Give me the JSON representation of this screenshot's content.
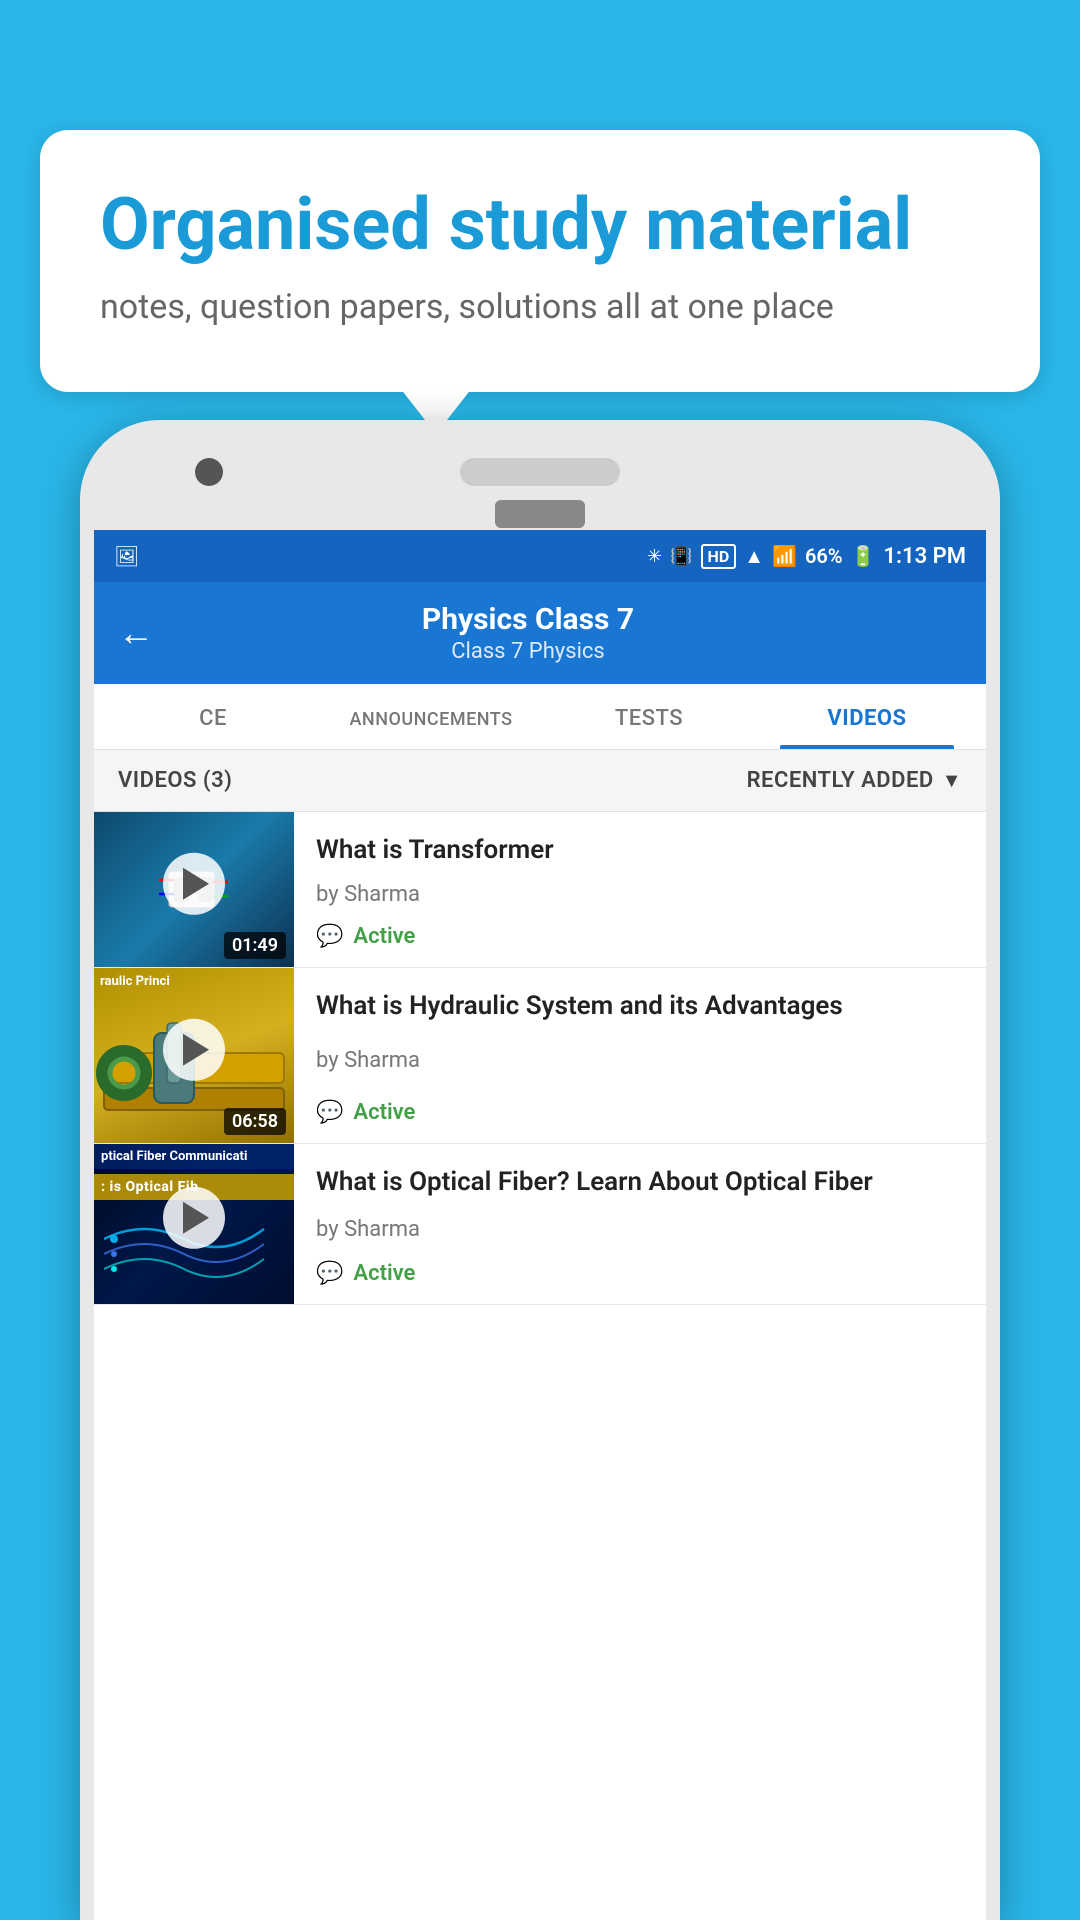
{
  "page": {
    "background_color": "#29b6e8"
  },
  "bubble": {
    "title": "Organised study material",
    "subtitle": "notes, question papers, solutions all at one place"
  },
  "status_bar": {
    "time": "1:13 PM",
    "battery": "66%",
    "signal_icons": "bluetooth vibrate hd wifi signal x"
  },
  "header": {
    "title": "Physics Class 7",
    "breadcrumb": "Class 7   Physics",
    "back_label": "←"
  },
  "tabs": [
    {
      "id": "ce",
      "label": "CE",
      "active": false
    },
    {
      "id": "announcements",
      "label": "ANNOUNCEMENTS",
      "active": false
    },
    {
      "id": "tests",
      "label": "TESTS",
      "active": false
    },
    {
      "id": "videos",
      "label": "VIDEOS",
      "active": true
    }
  ],
  "list_header": {
    "count_label": "VIDEOS (3)",
    "sort_label": "RECENTLY ADDED"
  },
  "videos": [
    {
      "id": "v1",
      "title": "What is  Transformer",
      "author": "by Sharma",
      "duration": "01:49",
      "status": "Active",
      "thumb_type": "transformer"
    },
    {
      "id": "v2",
      "title": "What is Hydraulic System and its Advantages",
      "author": "by Sharma",
      "duration": "06:58",
      "status": "Active",
      "thumb_type": "hydraulic",
      "thumb_label": "raulic Princi"
    },
    {
      "id": "v3",
      "title": "What is Optical Fiber? Learn About Optical Fiber",
      "author": "by Sharma",
      "duration": "",
      "status": "Active",
      "thumb_type": "optical",
      "thumb_label": "ptical Fiber Communicati"
    }
  ]
}
